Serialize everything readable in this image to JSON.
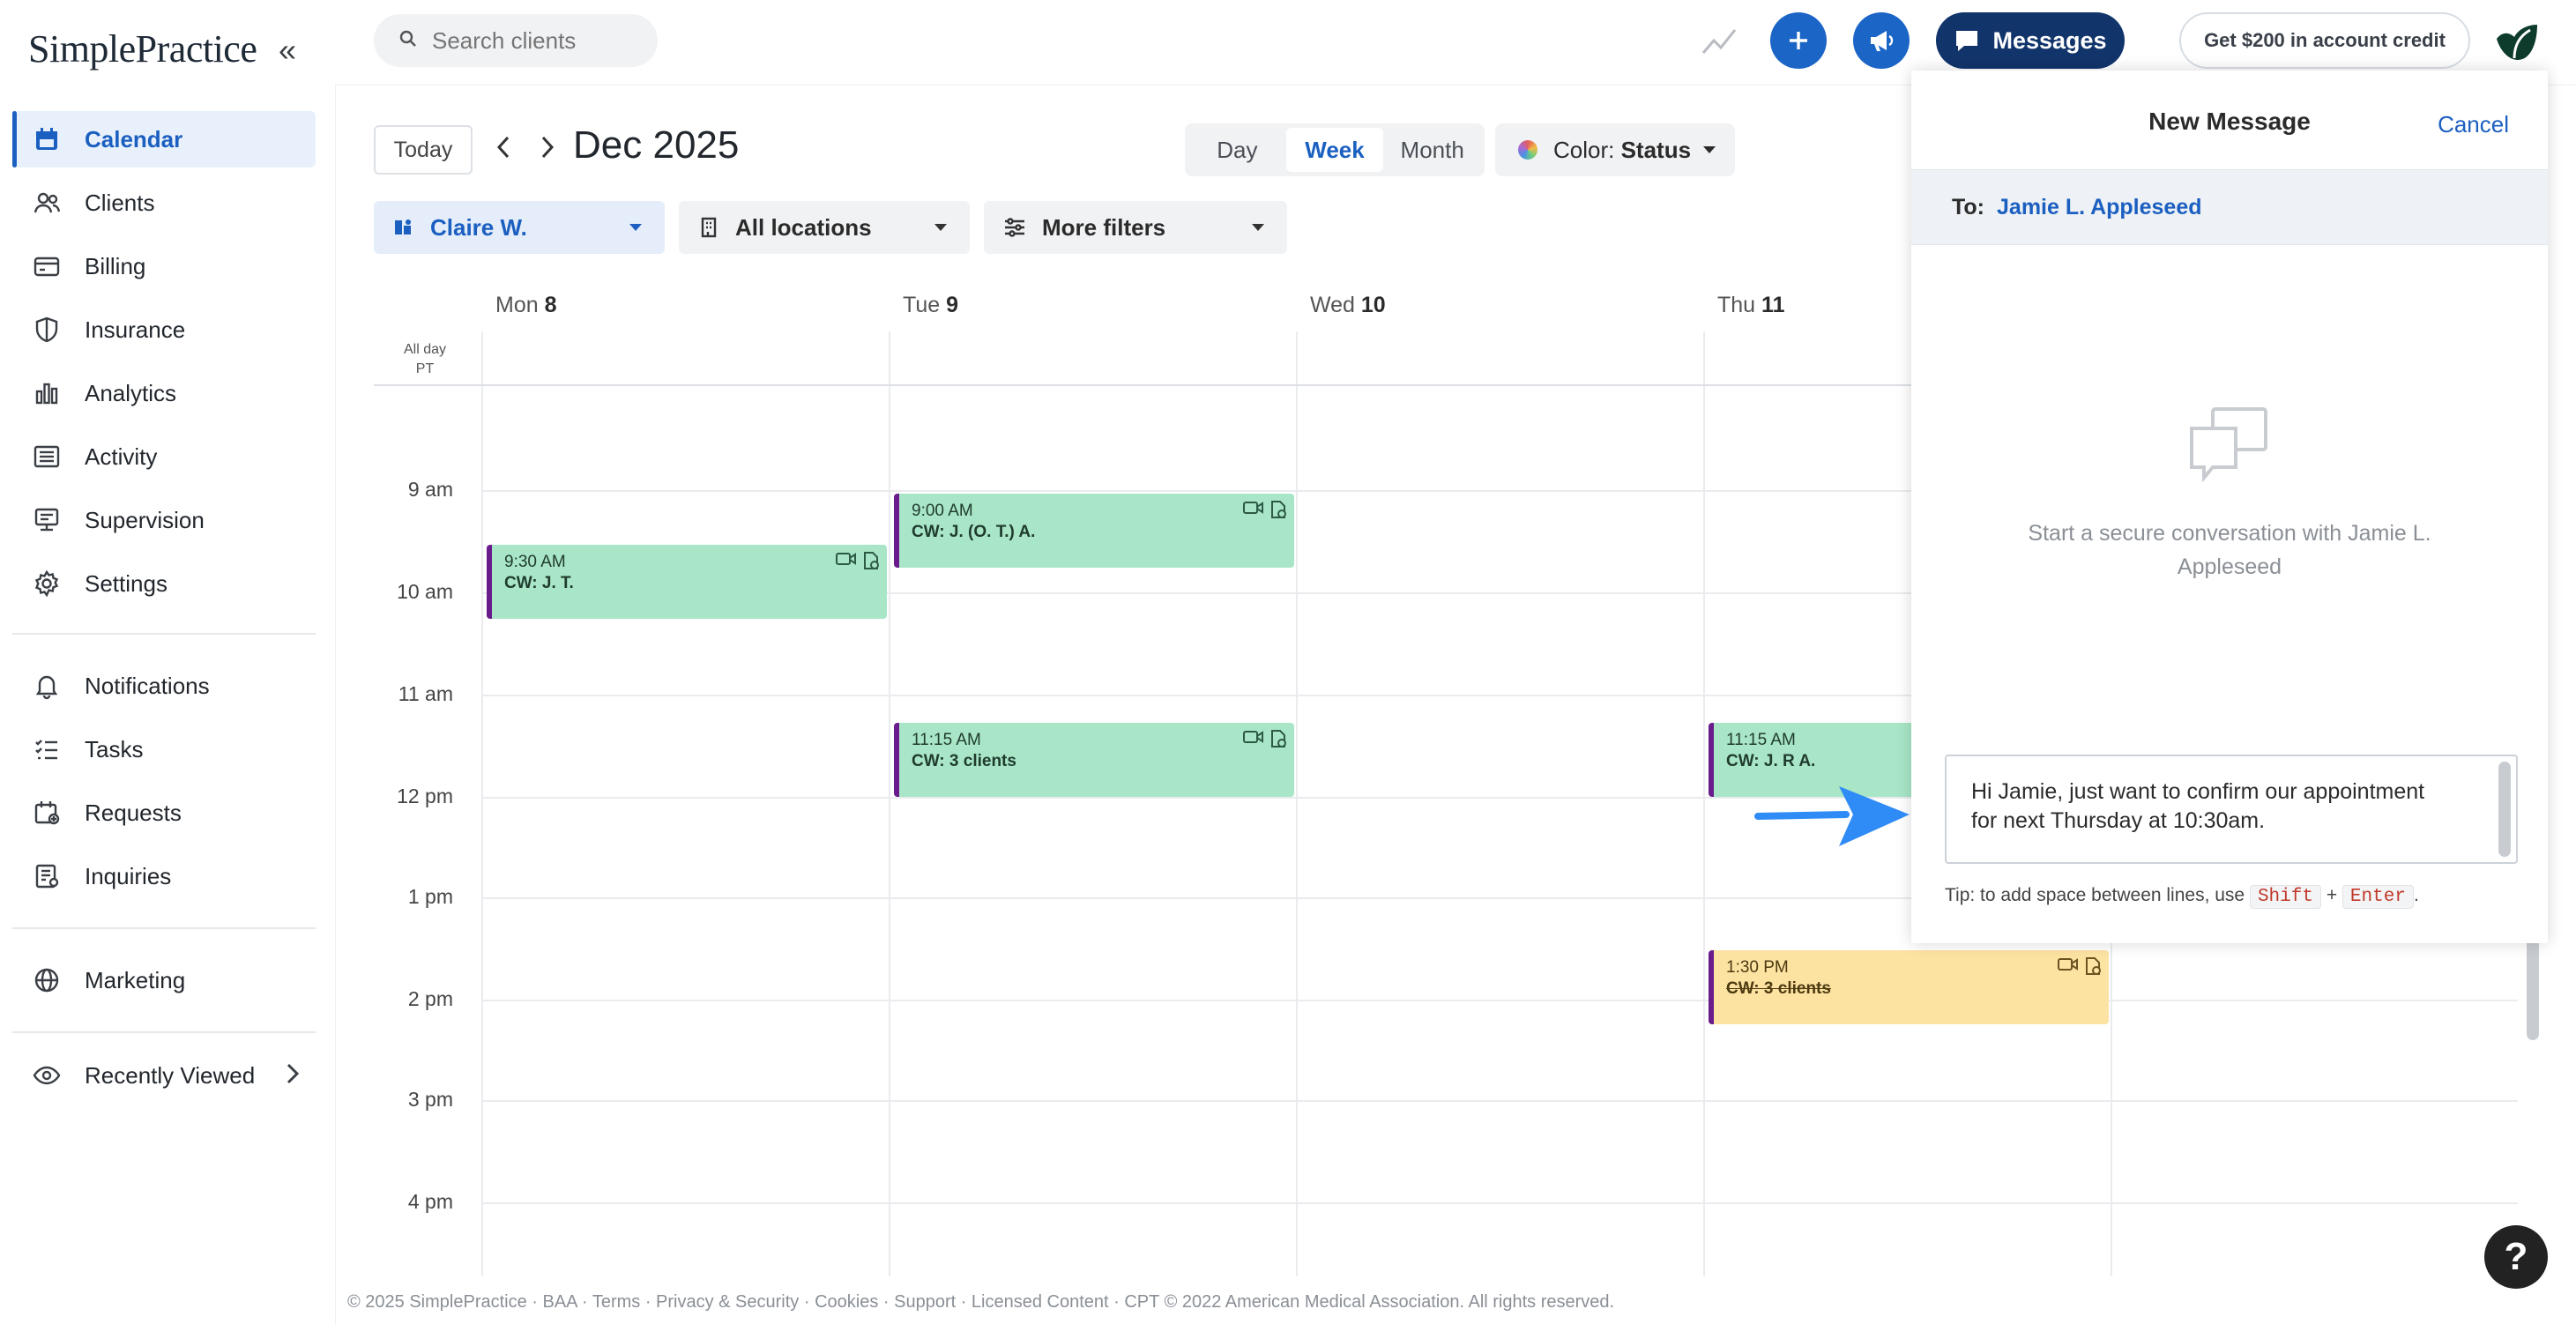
{
  "app": {
    "logo_text": "SimplePractice",
    "collapse_glyph": "«"
  },
  "sidebar": {
    "items": [
      {
        "label": "Calendar",
        "icon": "calendar-icon",
        "active": true
      },
      {
        "label": "Clients",
        "icon": "clients-icon"
      },
      {
        "label": "Billing",
        "icon": "billing-icon"
      },
      {
        "label": "Insurance",
        "icon": "shield-icon"
      },
      {
        "label": "Analytics",
        "icon": "analytics-icon"
      },
      {
        "label": "Activity",
        "icon": "activity-icon"
      },
      {
        "label": "Supervision",
        "icon": "supervision-icon"
      },
      {
        "label": "Settings",
        "icon": "gear-icon"
      },
      {
        "label": "Notifications",
        "icon": "bell-icon"
      },
      {
        "label": "Tasks",
        "icon": "tasks-icon"
      },
      {
        "label": "Requests",
        "icon": "requests-icon"
      },
      {
        "label": "Inquiries",
        "icon": "inquiries-icon"
      },
      {
        "label": "Marketing",
        "icon": "globe-icon"
      },
      {
        "label": "Recently Viewed",
        "icon": "eye-icon"
      }
    ]
  },
  "topbar": {
    "search_placeholder": "Search clients",
    "messages_label": "Messages",
    "credit_label": "Get $200 in account credit",
    "accent": "#1b65c7",
    "messages_bg": "#11346b"
  },
  "calendar": {
    "today_label": "Today",
    "prev_glyph": "‹",
    "next_glyph": "›",
    "month_title": "Dec 2025",
    "views": [
      "Day",
      "Week",
      "Month"
    ],
    "active_view": "Week",
    "color_label": "Color:",
    "color_value": "Status",
    "filters": {
      "clinician": "Claire W.",
      "locations": "All locations",
      "more": "More filters"
    },
    "days": [
      {
        "name": "Mon",
        "num": "8"
      },
      {
        "name": "Tue",
        "num": "9"
      },
      {
        "name": "Wed",
        "num": "10"
      },
      {
        "name": "Thu",
        "num": "11"
      }
    ],
    "allday_label": "All day",
    "tz_label": "PT",
    "hours": [
      "9 am",
      "10 am",
      "11 am",
      "12 pm",
      "1 pm",
      "2 pm",
      "3 pm",
      "4 pm"
    ],
    "appointments": [
      {
        "time": "9:30 AM",
        "name": "CW: J. T.",
        "status": "green"
      },
      {
        "time": "9:00 AM",
        "name": "CW: J. (O. T.) A.",
        "status": "green"
      },
      {
        "time": "11:15 AM",
        "name": "CW: 3 clients",
        "status": "green"
      },
      {
        "time": "11:15 AM",
        "name": "CW: J. R A.",
        "status": "green"
      },
      {
        "time": "1:30 PM",
        "name": "CW: 3 clients",
        "status": "yellow",
        "strikethrough": true
      }
    ],
    "colors": {
      "green": "#a8e6c7",
      "yellow": "#fde3a2",
      "bar": "#6a1b8c"
    }
  },
  "footer": {
    "text": "© 2025 SimplePractice · BAA · Terms · Privacy & Security · Cookies · Support · Licensed Content · CPT © 2022 American Medical Association. All rights reserved."
  },
  "message_panel": {
    "title": "New Message",
    "cancel_label": "Cancel",
    "to_label": "To:",
    "to_name": "Jamie L. Appleseed",
    "empty_text": "Start a secure conversation with Jamie L. Appleseed",
    "compose_value": "Hi Jamie, just want to confirm our appointment for next Thursday at 10:30am.",
    "tip_prefix": "Tip: to add space between lines, use",
    "tip_key1": "Shift",
    "tip_plus": "+",
    "tip_key2": "Enter",
    "tip_suffix": "."
  },
  "help": {
    "label": "?"
  }
}
